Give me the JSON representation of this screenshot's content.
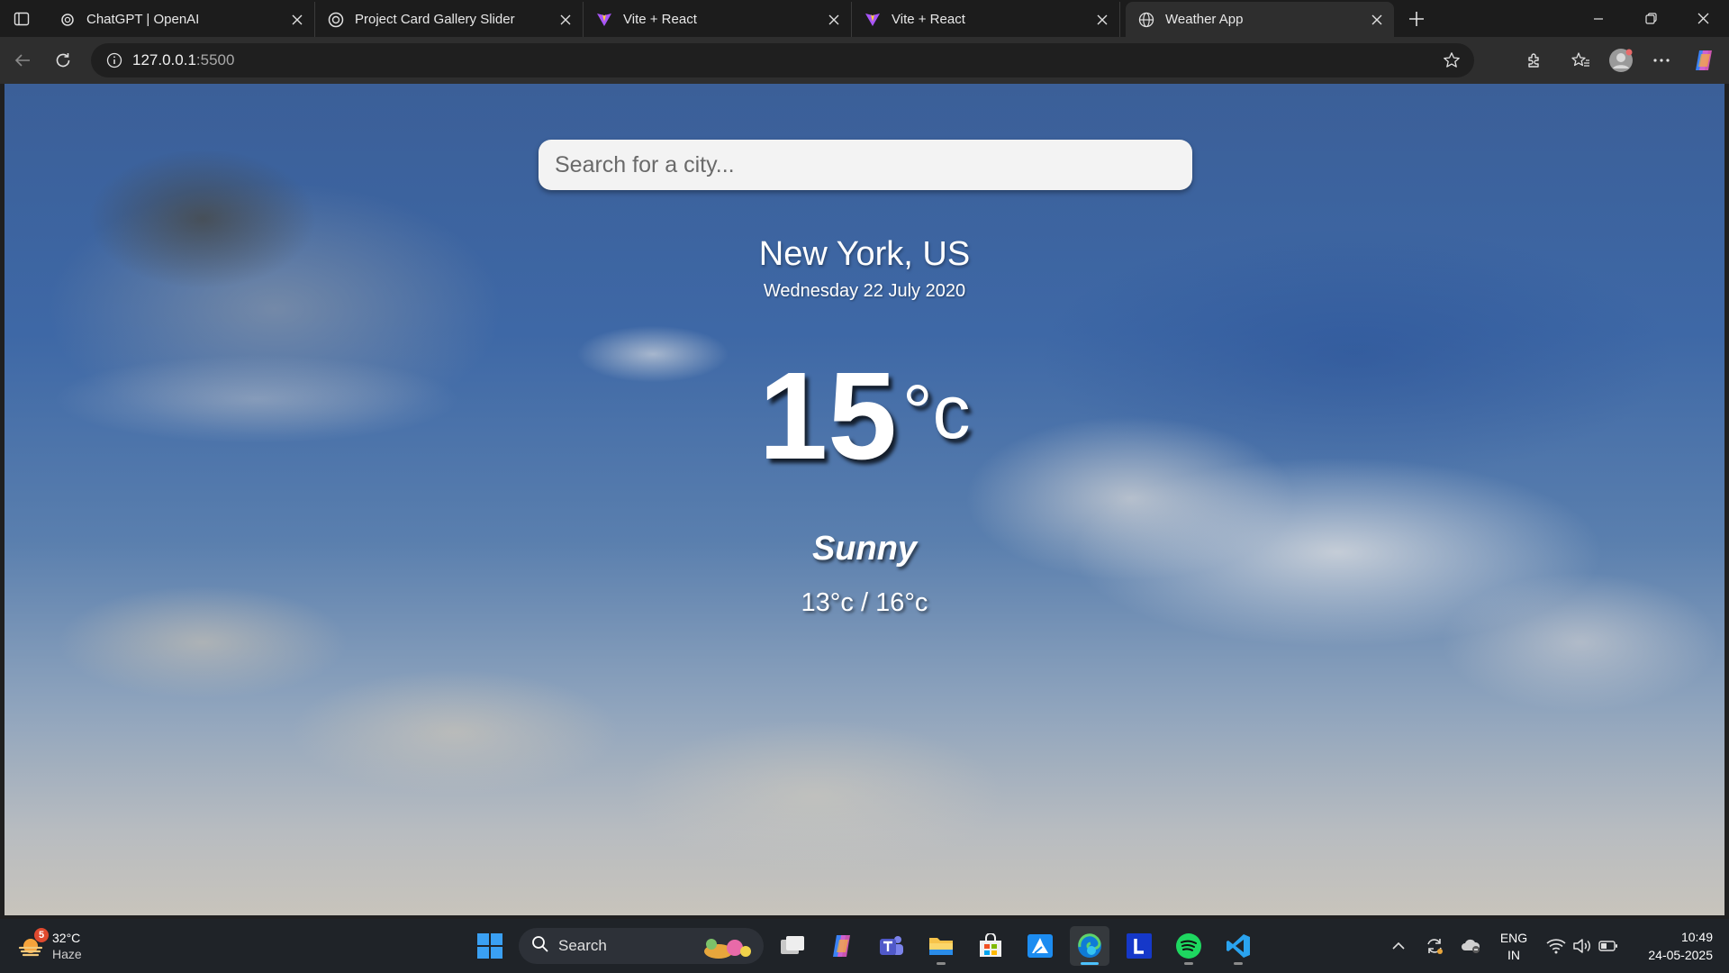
{
  "browser": {
    "tabs": [
      {
        "title": "ChatGPT | OpenAI",
        "icon": "openai-icon"
      },
      {
        "title": "Project Card Gallery Slider",
        "icon": "openai-icon"
      },
      {
        "title": "Vite + React",
        "icon": "vite-icon"
      },
      {
        "title": "Vite + React",
        "icon": "vite-icon"
      },
      {
        "title": "Weather App",
        "icon": "globe-icon",
        "active": true
      }
    ],
    "address": {
      "host": "127.0.0.1",
      "port": ":5500"
    }
  },
  "weather": {
    "search_placeholder": "Search for a city...",
    "city": "New York, US",
    "date": "Wednesday 22 July 2020",
    "temp": "15",
    "temp_unit": "°c",
    "condition": "Sunny",
    "hi_low": "13°c / 16°c"
  },
  "taskbar": {
    "weather_badge": "5",
    "weather_temp": "32°C",
    "weather_condition": "Haze",
    "search_label": "Search",
    "apps": [
      "start",
      "search",
      "task-view",
      "copilot",
      "teams",
      "file-explorer",
      "microsoft-store",
      "azure",
      "edge",
      "l-app",
      "spotify",
      "vscode"
    ],
    "lang_line1": "ENG",
    "lang_line2": "IN",
    "time": "10:49",
    "date": "24-05-2025"
  },
  "colors": {
    "accent": "#4cc2ff",
    "tab_bar": "#1c1c1c",
    "toolbar": "#2e2e2e",
    "taskbar": "#1f2328"
  }
}
